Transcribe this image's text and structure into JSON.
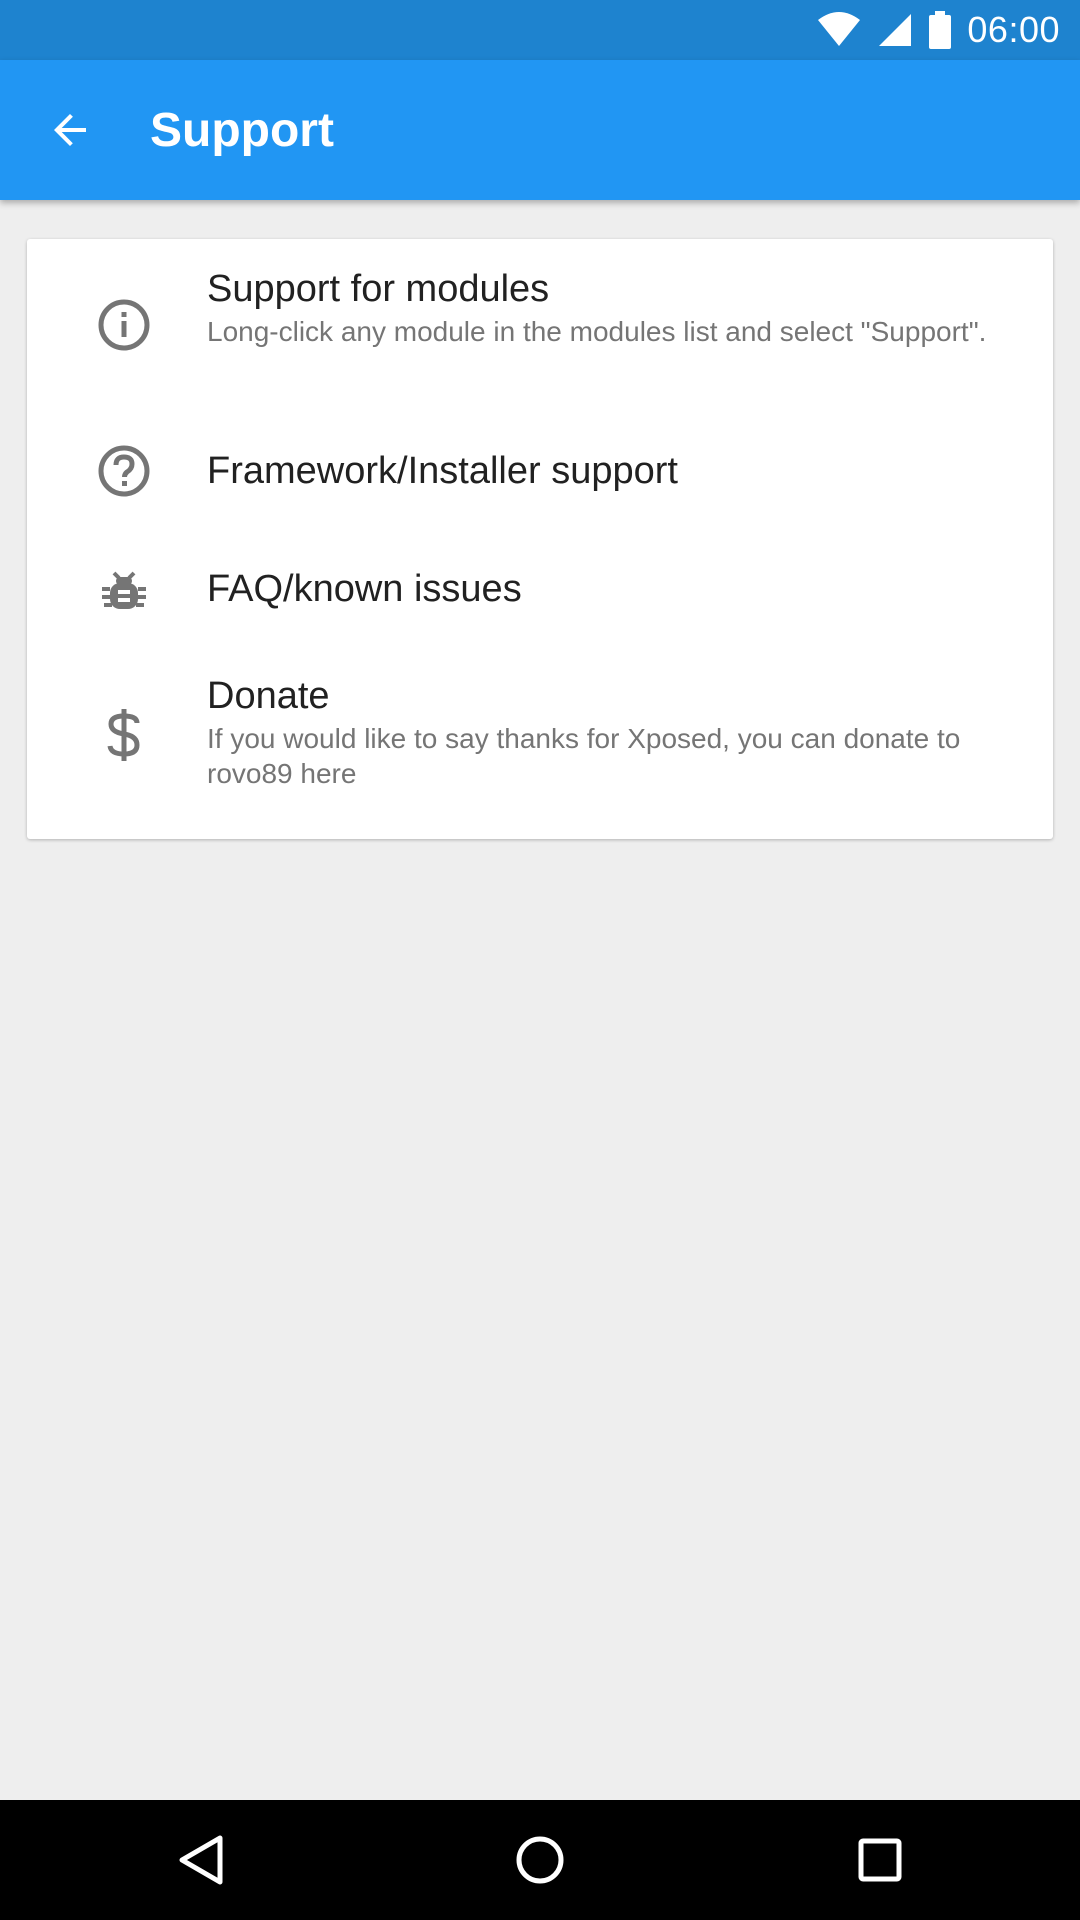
{
  "status_bar": {
    "time": "06:00",
    "icons": [
      "wifi-icon",
      "cell-signal-icon",
      "battery-icon"
    ]
  },
  "app_bar": {
    "title": "Support",
    "back_icon": "arrow-back-icon",
    "color": "#2196f3"
  },
  "list": {
    "items": [
      {
        "icon": "info-icon",
        "title": "Support for modules",
        "summary": "Long-click any module in the modules list and select \"Support\"."
      },
      {
        "icon": "help-icon",
        "title": "Framework/Installer support"
      },
      {
        "icon": "bug-icon",
        "title": "FAQ/known issues"
      },
      {
        "icon": "dollar-icon",
        "title": "Donate",
        "summary": "If you would like to say thanks for Xposed, you can donate to rovo89 here"
      }
    ]
  },
  "nav_bar": {
    "buttons": [
      "nav-back-icon",
      "nav-home-icon",
      "nav-recents-icon"
    ]
  },
  "colors": {
    "status_bar": "#1e83cf",
    "app_bar": "#2196f3",
    "background": "#eeeeee",
    "icon": "#757575"
  }
}
